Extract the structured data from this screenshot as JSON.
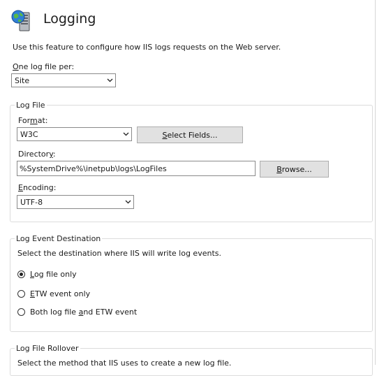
{
  "header": {
    "title": "Logging",
    "description": "Use this feature to configure how IIS logs requests on the Web server."
  },
  "one_log_file_per": {
    "label_underlined": "O",
    "label_rest": "ne log file per:",
    "value": "Site"
  },
  "log_file": {
    "title": "Log File",
    "format": {
      "label_pre": "For",
      "label_underlined": "m",
      "label_post": "at:",
      "value": "W3C"
    },
    "select_fields_button": {
      "underlined": "S",
      "rest": "elect Fields..."
    },
    "directory": {
      "label_pre": "Director",
      "label_underlined": "y",
      "label_post": ":",
      "value": "%SystemDrive%\\inetpub\\logs\\LogFiles"
    },
    "browse_button": {
      "underlined": "B",
      "rest": "rowse..."
    },
    "encoding": {
      "label_underlined": "E",
      "label_rest": "ncoding:",
      "value": "UTF-8"
    }
  },
  "log_event_destination": {
    "title": "Log Event Destination",
    "description": "Select the destination where IIS will write log events.",
    "options": [
      {
        "pre": "",
        "underlined": "L",
        "post": "og file only",
        "checked": true
      },
      {
        "pre": "",
        "underlined": "E",
        "post": "TW event only",
        "checked": false
      },
      {
        "pre": "Both log file ",
        "underlined": "a",
        "post": "nd ETW event",
        "checked": false
      }
    ]
  },
  "log_file_rollover": {
    "title": "Log File Rollover",
    "description": "Select the method that IIS uses to create a new log file."
  },
  "icons": {
    "feature_icon": "globe-server-icon",
    "dropdown_icon": "chevron-down-icon"
  }
}
